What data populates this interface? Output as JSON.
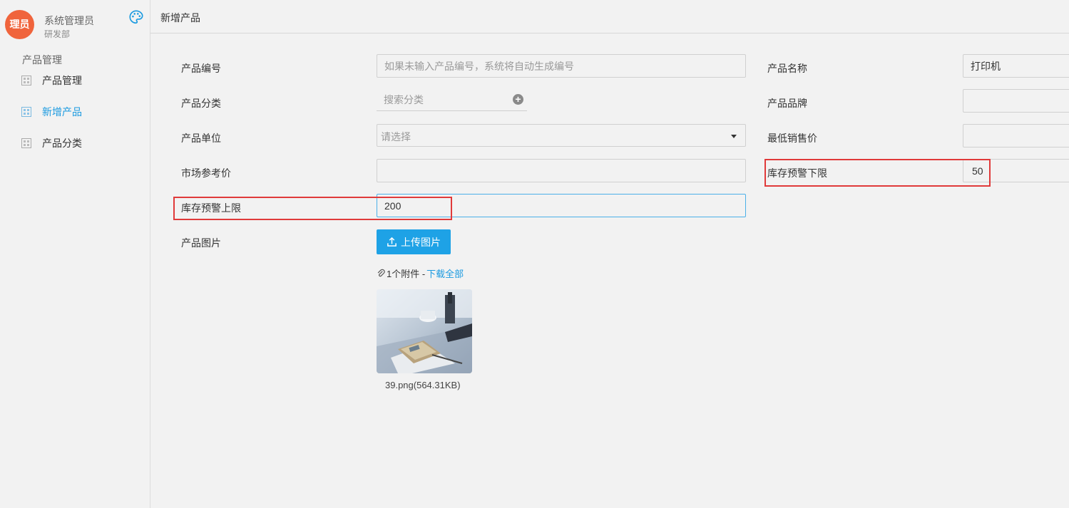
{
  "user": {
    "avatar_text": "理员",
    "name": "系统管理员",
    "dept": "研发部"
  },
  "sidebar": {
    "group_label": "产品管理",
    "items": [
      {
        "label": "产品管理",
        "active": false
      },
      {
        "label": "新增产品",
        "active": true
      },
      {
        "label": "产品分类",
        "active": false
      }
    ]
  },
  "header": {
    "title": "新增产品"
  },
  "form": {
    "product_code": {
      "label": "产品编号",
      "placeholder": "如果未输入产品编号，系统将自动生成编号",
      "value": ""
    },
    "product_name": {
      "label": "产品名称",
      "value": "打印机"
    },
    "category": {
      "label": "产品分类",
      "placeholder": "搜索分类"
    },
    "brand": {
      "label": "产品品牌",
      "value": ""
    },
    "unit": {
      "label": "产品单位",
      "placeholder": "请选择"
    },
    "min_price": {
      "label": "最低销售价",
      "value": ""
    },
    "market_price": {
      "label": "市场参考价",
      "value": ""
    },
    "stock_lower": {
      "label": "库存预警下限",
      "value": "50"
    },
    "stock_upper": {
      "label": "库存预警上限",
      "value": "200"
    },
    "image": {
      "label": "产品图片",
      "upload_label": "上传图片"
    },
    "attachments": {
      "count_text": "1个附件 -",
      "download_all": "下载全部",
      "file_caption": "39.png(564.31KB)"
    }
  },
  "colors": {
    "accent": "#1ea2e6",
    "avatar": "#f0643c",
    "highlight": "#e03a3a"
  }
}
